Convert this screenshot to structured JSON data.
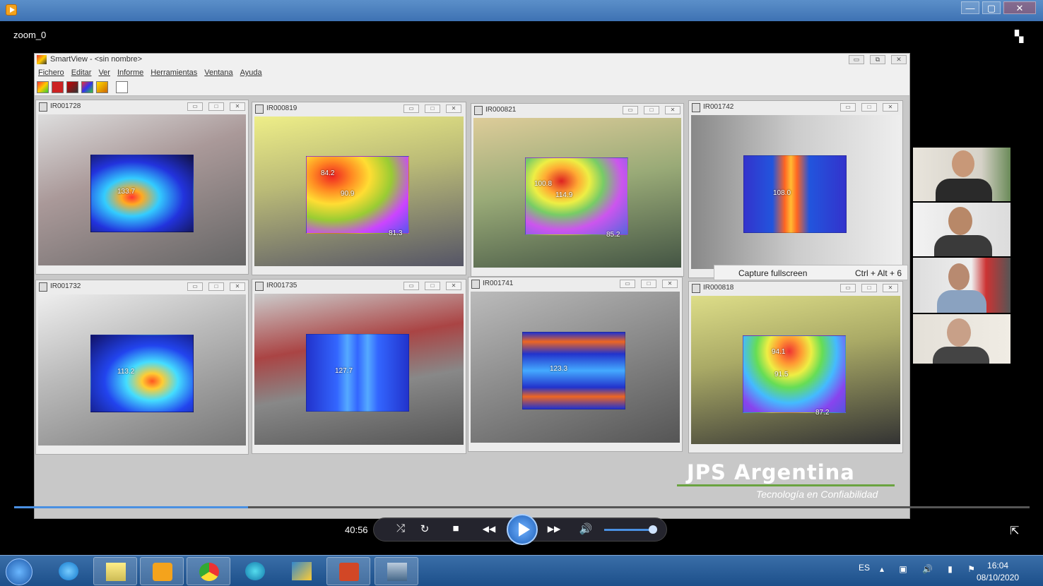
{
  "os_window": {
    "controls": [
      "—",
      "▢",
      "✕"
    ]
  },
  "player": {
    "title": "zoom_0",
    "time": "40:56",
    "progress": 0.23,
    "volume": 0.87,
    "controls": {
      "shuffle": "⤮",
      "repeat": "↻",
      "stop": "■",
      "prev": "◀◀",
      "next": "▶▶",
      "volume": "🔊"
    }
  },
  "smartview": {
    "title": "SmartView - <sin nombre>",
    "menu": [
      "Fichero",
      "Editar",
      "Ver",
      "Informe",
      "Herramientas",
      "Ventana",
      "Ayuda"
    ],
    "window_controls": [
      "▭",
      "⧉",
      "✕"
    ],
    "images": [
      {
        "title": "IR001728",
        "labels": [
          "133.7"
        ]
      },
      {
        "title": "IR000819",
        "labels": [
          "84.2",
          "90.9",
          "81.3"
        ]
      },
      {
        "title": "IR000821",
        "labels": [
          "100.8",
          "114.9",
          "85.2"
        ]
      },
      {
        "title": "IR001742",
        "labels": [
          "108.0"
        ]
      },
      {
        "title": "IR001732",
        "labels": [
          "113.2"
        ]
      },
      {
        "title": "IR001735",
        "labels": [
          "127.7"
        ]
      },
      {
        "title": "IR001741",
        "labels": [
          "123.3"
        ]
      },
      {
        "title": "IR000818",
        "labels": [
          "94.1",
          "91.5",
          "87.2"
        ]
      }
    ]
  },
  "context_menu": {
    "label": "Capture fullscreen",
    "shortcut": "Ctrl + Alt + 6"
  },
  "brand": {
    "name": "JPS Argentina",
    "tagline": "Tecnología en Confiabilidad",
    "accent": "#6aa340"
  },
  "taskbar": {
    "language": "ES",
    "time": "16:04",
    "date": "08/10/2020",
    "apps": [
      "internet-explorer",
      "file-explorer",
      "media-player",
      "chrome",
      "edge",
      "winamp",
      "powerpoint",
      "remote-desktop"
    ]
  }
}
